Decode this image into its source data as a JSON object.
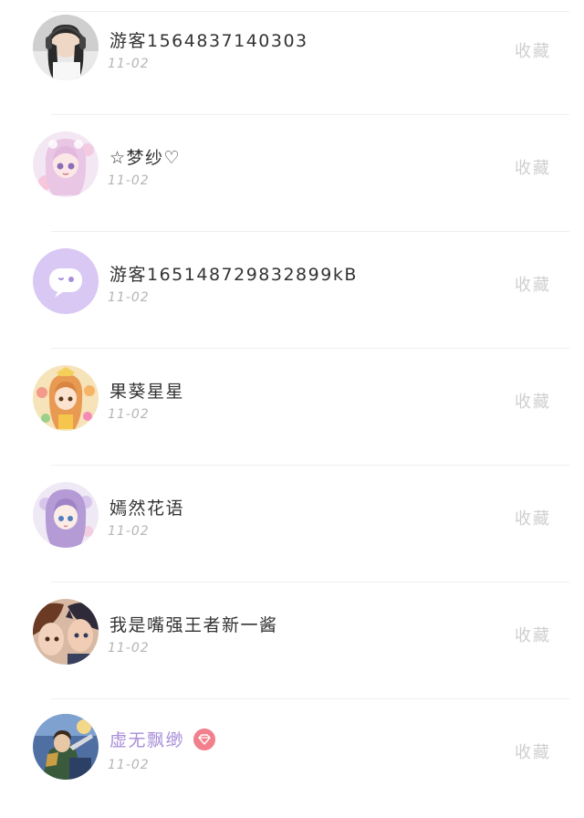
{
  "users": [
    {
      "name": "游客1564837140303",
      "date": "11-02",
      "action": "收藏",
      "avatar_icon": "girl-headphones-avatar-icon",
      "vip": false
    },
    {
      "name": "☆梦纱♡",
      "date": "11-02",
      "action": "收藏",
      "avatar_icon": "anime-pink-girl-avatar-icon",
      "vip": false
    },
    {
      "name": "游客16514872983289​9kB",
      "date": "11-02",
      "action": "收藏",
      "avatar_icon": "default-chat-bubble-avatar-icon",
      "vip": false
    },
    {
      "name": "果葵星星",
      "date": "11-02",
      "action": "收藏",
      "avatar_icon": "anime-orange-girl-avatar-icon",
      "vip": false
    },
    {
      "name": "嫣然花语",
      "date": "11-02",
      "action": "收藏",
      "avatar_icon": "anime-purple-girl-avatar-icon",
      "vip": false
    },
    {
      "name": "我是嘴强王者新一酱",
      "date": "11-02",
      "action": "收藏",
      "avatar_icon": "anime-couple-avatar-icon",
      "vip": false
    },
    {
      "name": "虚无飘缈",
      "date": "11-02",
      "action": "收藏",
      "avatar_icon": "game-character-avatar-icon",
      "vip": true,
      "badge_icon": "diamond-vip-icon"
    }
  ],
  "colors": {
    "name_text": "#333333",
    "vip_name_text": "#a98ed8",
    "date_text": "#b5b5b5",
    "action_text": "#cfcfcf",
    "vip_badge": "#f17f8c",
    "default_avatar_bg": "#d8c8f3"
  }
}
